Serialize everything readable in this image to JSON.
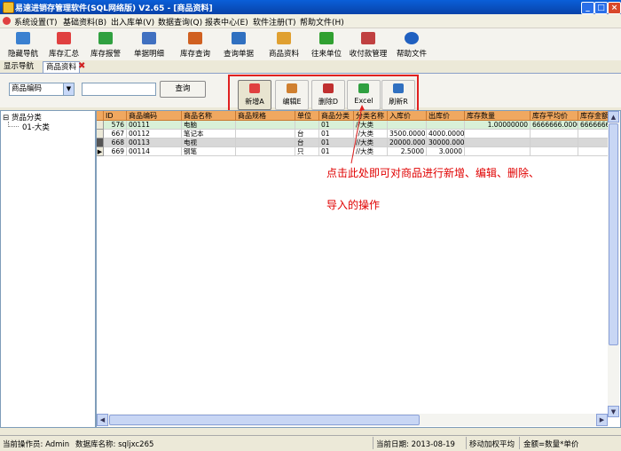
{
  "window": {
    "title": "易速进销存管理软件(SQL网络版) V2.65 - [商品资料]",
    "min": "_",
    "max": "□",
    "close": "×"
  },
  "menu": [
    "系统设置(T)",
    "基础资料(B)",
    "出入库单(V)",
    "数据查询(Q)",
    "报表中心(E)",
    "软件注册(T)",
    "帮助文件(H)"
  ],
  "toolbar": [
    {
      "label": "隐藏导航",
      "icon": "monitor-icon",
      "color": "#3a80d0"
    },
    {
      "label": "库存汇总",
      "icon": "chart-icon",
      "color": "#e04040"
    },
    {
      "label": "库存报警",
      "icon": "alarm-icon",
      "color": "#30a040"
    },
    {
      "label": "单据明细",
      "icon": "document-icon",
      "color": "#4070c0"
    },
    {
      "label": "库存查询",
      "icon": "search-person-icon",
      "color": "#d06020"
    },
    {
      "label": "查询单据",
      "icon": "query-icon",
      "color": "#3070c0"
    },
    {
      "label": "商品资料",
      "icon": "box-icon",
      "color": "#e0a030"
    },
    {
      "label": "往来单位",
      "icon": "people-icon",
      "color": "#30a030"
    },
    {
      "label": "收付款管理",
      "icon": "money-icon",
      "color": "#c04040"
    },
    {
      "label": "帮助文件",
      "icon": "help-icon",
      "color": "#2060c0"
    }
  ],
  "tabs": [
    {
      "label": "显示导航",
      "active": false
    },
    {
      "label": "商品资料",
      "active": true
    }
  ],
  "search": {
    "field_value": "商品编码",
    "dropdown_arrow": "▼",
    "input_value": "",
    "query_label": "查询"
  },
  "actions": [
    {
      "label": "新增A",
      "icon": "add-icon",
      "color": "#e04040"
    },
    {
      "label": "编辑E",
      "icon": "edit-icon",
      "color": "#d08030"
    },
    {
      "label": "删除D",
      "icon": "delete-icon",
      "color": "#c03030"
    },
    {
      "label": "Excel",
      "icon": "excel-icon",
      "color": "#30a040"
    },
    {
      "label": "刷新R",
      "icon": "refresh-icon",
      "color": "#3070c0"
    }
  ],
  "tree": {
    "root": "货品分类",
    "child": "01-大类",
    "expander": "⊟"
  },
  "grid": {
    "columns": [
      "ID",
      "商品编码",
      "商品名称",
      "商品规格",
      "单位",
      "商品分类",
      "分类名称",
      "入库价",
      "出库价",
      "库存数量",
      "库存平均价",
      "库存金额"
    ],
    "rows": [
      [
        "576",
        "00111",
        "电脑",
        "",
        "",
        "01",
        "//大类",
        "",
        "",
        "1.00000000",
        "6666666.0000",
        "6666666."
      ],
      [
        "667",
        "00112",
        "笔记本",
        "",
        "台",
        "01",
        "//大类",
        "3500.0000",
        "4000.0000",
        "",
        "",
        ""
      ],
      [
        "668",
        "00113",
        "电视",
        "",
        "台",
        "01",
        "//大类",
        "20000.0000",
        "30000.0000",
        "",
        "",
        ""
      ],
      [
        "669",
        "00114",
        "钢笔",
        "",
        "只",
        "01",
        "//大类",
        "2.5000",
        "3.0000",
        "",
        "",
        ""
      ]
    ]
  },
  "annotation": {
    "line1": "点击此处即可对商品进行新增、编辑、删除、",
    "line2": "导入的操作"
  },
  "status": {
    "operator": "当前操作员: Admin",
    "database": "数据库名称: sqljxc265",
    "date": "当前日期: 2013-08-19",
    "method": "移动加权平均",
    "formula": "金额=数量*单价"
  }
}
